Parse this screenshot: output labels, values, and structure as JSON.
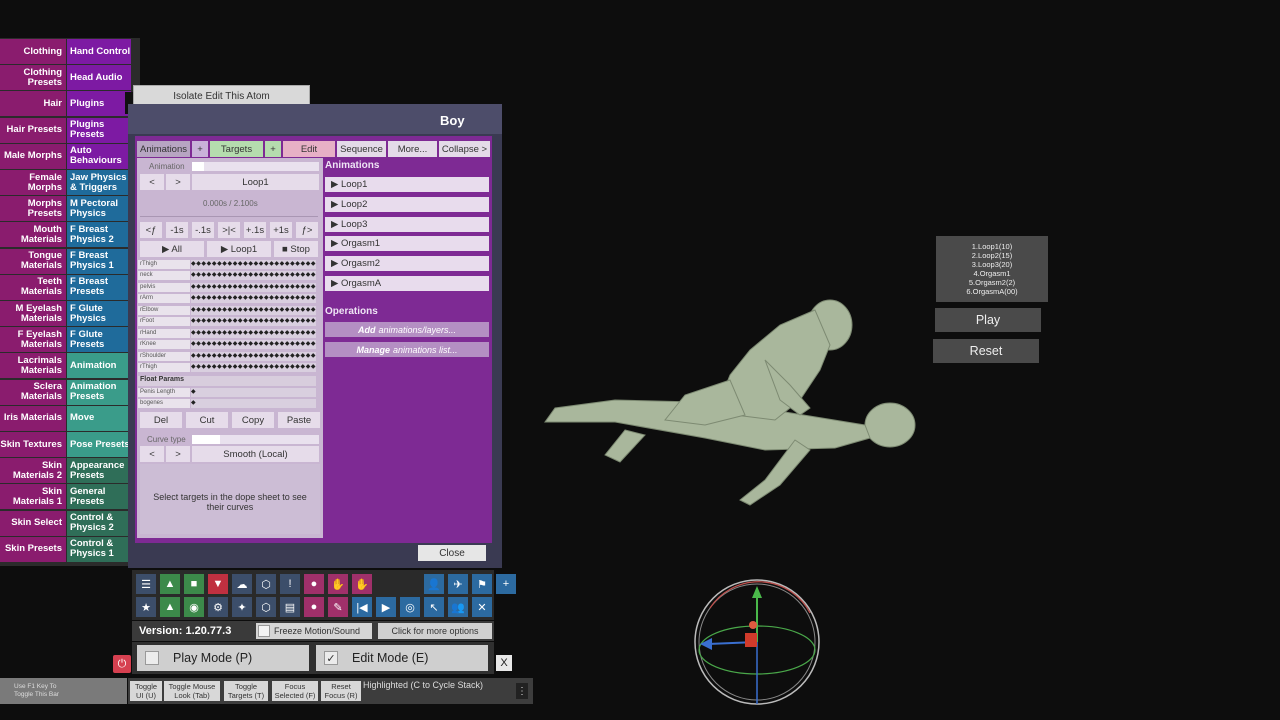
{
  "left_menu": [
    {
      "left": "Clothing",
      "right": "Hand Control",
      "right_color": "purple"
    },
    {
      "left": "Clothing Presets",
      "right": "Head Audio",
      "right_color": "purple"
    },
    {
      "left": "Hair",
      "right": "Plugins",
      "right_color": "purple"
    },
    {
      "left": "Hair Presets",
      "right": "Plugins Presets",
      "right_color": "purple"
    },
    {
      "left": "Male Morphs",
      "right": "Auto Behaviours",
      "right_color": "purple"
    },
    {
      "left": "Female Morphs",
      "right": "Jaw Physics & Triggers",
      "right_color": "blue"
    },
    {
      "left": "Morphs Presets",
      "right": "M Pectoral Physics",
      "right_color": "blue"
    },
    {
      "left": "Mouth Materials",
      "right": "F Breast Physics 2",
      "right_color": "blue"
    },
    {
      "left": "Tongue Materials",
      "right": "F Breast Physics 1",
      "right_color": "blue"
    },
    {
      "left": "Teeth Materials",
      "right": "F Breast Presets",
      "right_color": "blue"
    },
    {
      "left": "M Eyelash Materials",
      "right": "F Glute Physics",
      "right_color": "blue"
    },
    {
      "left": "F Eyelash Materials",
      "right": "F Glute Presets",
      "right_color": "blue"
    },
    {
      "left": "Lacrimals Materials",
      "right": "Animation",
      "right_color": "teal"
    },
    {
      "left": "Sclera Materials",
      "right": "Animation Presets",
      "right_color": "teal"
    },
    {
      "left": "Iris Materials",
      "right": "Move",
      "right_color": "teal"
    },
    {
      "left": "Skin Textures",
      "right": "Pose Presets",
      "right_color": "teal"
    },
    {
      "left": "Skin Materials 2",
      "right": "Appearance Presets",
      "right_color": "green"
    },
    {
      "left": "Skin Materials 1",
      "right": "General Presets",
      "right_color": "green"
    },
    {
      "left": "Skin Select",
      "right": "Control & Physics 2",
      "right_color": "green"
    },
    {
      "left": "Skin Presets",
      "right": "Control & Physics 1",
      "right_color": "green"
    }
  ],
  "isolate_button": "Isolate Edit This Atom",
  "panel_title": "Boy",
  "toolbar": {
    "animations": "Animations",
    "plus1": "+",
    "targets": "Targets",
    "plus2": "+",
    "edit": "Edit",
    "sequence": "Sequence",
    "more": "More...",
    "collapse": "Collapse >"
  },
  "left_controls": {
    "animation_label": "Animation",
    "prev": "<",
    "next": ">",
    "current_animation": "Loop1",
    "time": "0.000s / 2.100s",
    "step_buttons": [
      "<ƒ",
      "-1s",
      "-.1s",
      ">|<",
      "+.1s",
      "+1s",
      "ƒ>"
    ],
    "play_all": "▶ All",
    "play_loop": "▶ Loop1",
    "stop": "■ Stop",
    "float_params": "Float Params",
    "del": "Del",
    "cut": "Cut",
    "copy": "Copy",
    "paste": "Paste",
    "curve_type_label": "Curve type",
    "curve_prev": "<",
    "curve_next": ">",
    "curve_type": "Smooth (Local)",
    "hint": "Select targets in the dope sheet to see their curves"
  },
  "dope_rows": [
    "rThigh",
    "neck",
    "pelvis",
    "rArm",
    "rElbow",
    "rFoot",
    "rHand",
    "rKnee",
    "rShoulder",
    "rThigh"
  ],
  "float_rows": [
    "Penis Length",
    "bogenes"
  ],
  "keys": "◆◆◆◆◆◆◆◆◆◆◆◆◆◆◆◆◆◆◆◆◆◆◆◆◆◆◆◆",
  "animations_header": "Animations",
  "animations": [
    "▶ Loop1",
    "▶ Loop2",
    "▶ Loop3",
    "▶ Orgasm1",
    "▶ Orgasm2",
    "▶ OrgasmA"
  ],
  "operations_header": "Operations",
  "operations": [
    {
      "verb": "Add",
      "rest": "animations/layers..."
    },
    {
      "verb": "Manage",
      "rest": "animations list..."
    }
  ],
  "close_button": "Close",
  "version": "Version: 1.20.77.3",
  "freeze": "Freeze Motion/Sound",
  "more_options": "Click for more options",
  "play_mode": "Play Mode (P)",
  "edit_mode": "Edit Mode (E)",
  "edit_check": "✓",
  "x_button": "X",
  "power_icon": "⏻",
  "f1_hint": [
    "Use F1 Key To",
    "Toggle This Bar"
  ],
  "bottom_buttons": [
    [
      "Toggle",
      "UI (U)"
    ],
    [
      "Toggle Mouse",
      "Look (Tab)"
    ],
    [
      "Toggle",
      "Targets (T)"
    ],
    [
      "Focus",
      "Selected (F)"
    ],
    [
      "Reset",
      "Focus (R)"
    ]
  ],
  "highlighted": "Highlighted (C to Cycle Stack)",
  "kebab": "⋮",
  "anim_list": [
    "1.Loop1(10)",
    "2.Loop2(15)",
    "3.Loop3(20)",
    "4.Orgasm1",
    "5.Orgasm2(2)",
    "6.OrgasmA(00)"
  ],
  "play_button": "Play",
  "reset_button": "Reset",
  "icons_row1": [
    "☰",
    "▲",
    "■",
    "▼",
    "☁",
    "⬡",
    "!",
    "●",
    "✋",
    "✋",
    "",
    "",
    "👤",
    "✈",
    "⚑",
    "+"
  ],
  "icons_row2": [
    "★",
    "▲",
    "◉",
    "⚙",
    "✦",
    "⬡",
    "▤",
    "●",
    "✎",
    "|◀",
    "▶",
    "◎",
    "↖",
    "👥",
    "✕"
  ],
  "colors": {
    "menu_left": "#8a1c6e",
    "panel_inner": "#7e2a94"
  }
}
